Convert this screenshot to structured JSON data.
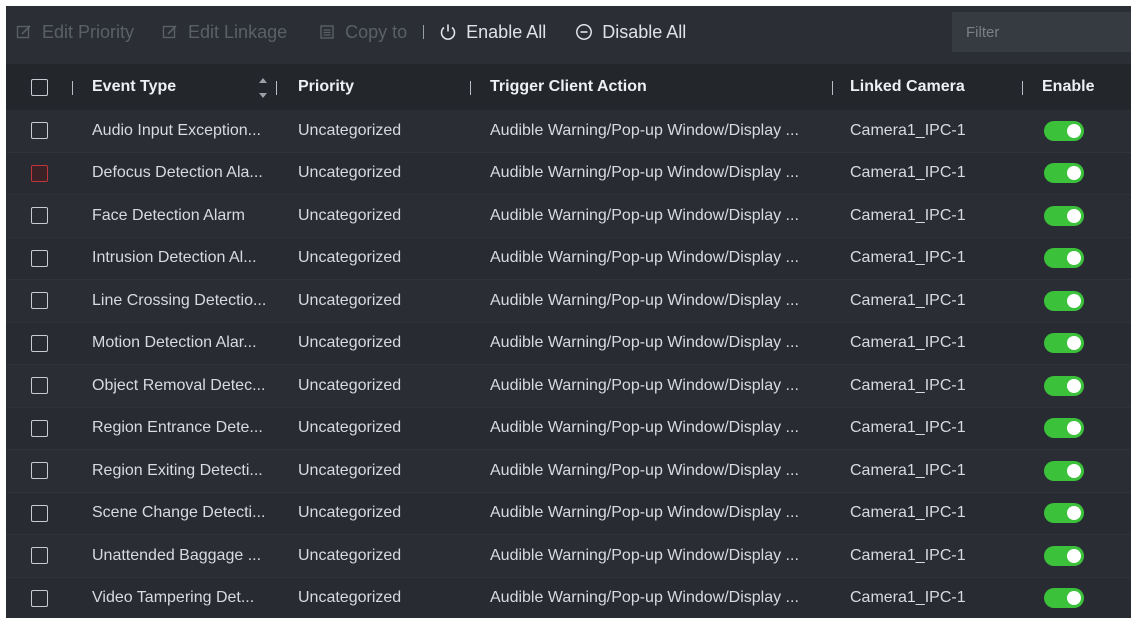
{
  "toolbar": {
    "edit_priority": "Edit Priority",
    "edit_linkage": "Edit Linkage",
    "copy_to": "Copy to",
    "enable_all": "Enable All",
    "disable_all": "Disable All",
    "filter_placeholder": "Filter"
  },
  "table": {
    "headers": {
      "event_type": "Event Type",
      "priority": "Priority",
      "trigger_client_action": "Trigger Client Action",
      "linked_camera": "Linked Camera",
      "enable": "Enable"
    },
    "rows": [
      {
        "event_type": "Audio Input Exception...",
        "priority": "Uncategorized",
        "action": "Audible Warning/Pop-up Window/Display ...",
        "camera": "Camera1_IPC-1",
        "enabled": true
      },
      {
        "event_type": "Defocus Detection Ala...",
        "priority": "Uncategorized",
        "action": "Audible Warning/Pop-up Window/Display ...",
        "camera": "Camera1_IPC-1",
        "enabled": true
      },
      {
        "event_type": "Face Detection Alarm",
        "priority": "Uncategorized",
        "action": "Audible Warning/Pop-up Window/Display ...",
        "camera": "Camera1_IPC-1",
        "enabled": true
      },
      {
        "event_type": "Intrusion Detection Al...",
        "priority": "Uncategorized",
        "action": "Audible Warning/Pop-up Window/Display ...",
        "camera": "Camera1_IPC-1",
        "enabled": true
      },
      {
        "event_type": "Line Crossing Detectio...",
        "priority": "Uncategorized",
        "action": "Audible Warning/Pop-up Window/Display ...",
        "camera": "Camera1_IPC-1",
        "enabled": true
      },
      {
        "event_type": "Motion Detection Alar...",
        "priority": "Uncategorized",
        "action": "Audible Warning/Pop-up Window/Display ...",
        "camera": "Camera1_IPC-1",
        "enabled": true
      },
      {
        "event_type": "Object Removal Detec...",
        "priority": "Uncategorized",
        "action": "Audible Warning/Pop-up Window/Display ...",
        "camera": "Camera1_IPC-1",
        "enabled": true
      },
      {
        "event_type": "Region Entrance Dete...",
        "priority": "Uncategorized",
        "action": "Audible Warning/Pop-up Window/Display ...",
        "camera": "Camera1_IPC-1",
        "enabled": true
      },
      {
        "event_type": "Region Exiting Detecti...",
        "priority": "Uncategorized",
        "action": "Audible Warning/Pop-up Window/Display ...",
        "camera": "Camera1_IPC-1",
        "enabled": true
      },
      {
        "event_type": "Scene Change Detecti...",
        "priority": "Uncategorized",
        "action": "Audible Warning/Pop-up Window/Display ...",
        "camera": "Camera1_IPC-1",
        "enabled": true
      },
      {
        "event_type": "Unattended Baggage ...",
        "priority": "Uncategorized",
        "action": "Audible Warning/Pop-up Window/Display ...",
        "camera": "Camera1_IPC-1",
        "enabled": true
      },
      {
        "event_type": "Video Tampering Det...",
        "priority": "Uncategorized",
        "action": "Audible Warning/Pop-up Window/Display ...",
        "camera": "Camera1_IPC-1",
        "enabled": true
      }
    ]
  },
  "colors": {
    "background": "#2b2e34",
    "header_background": "#23262b",
    "toggle_on": "#3cc13b",
    "warning_checkbox": "#c0343a",
    "disabled_text": "#5b6068"
  },
  "icons": {
    "edit_priority": "edit-icon",
    "edit_linkage": "edit-icon",
    "copy_to": "copy-icon",
    "enable_all": "power-icon",
    "disable_all": "minus-circle-icon",
    "sort": "sort-icon"
  }
}
